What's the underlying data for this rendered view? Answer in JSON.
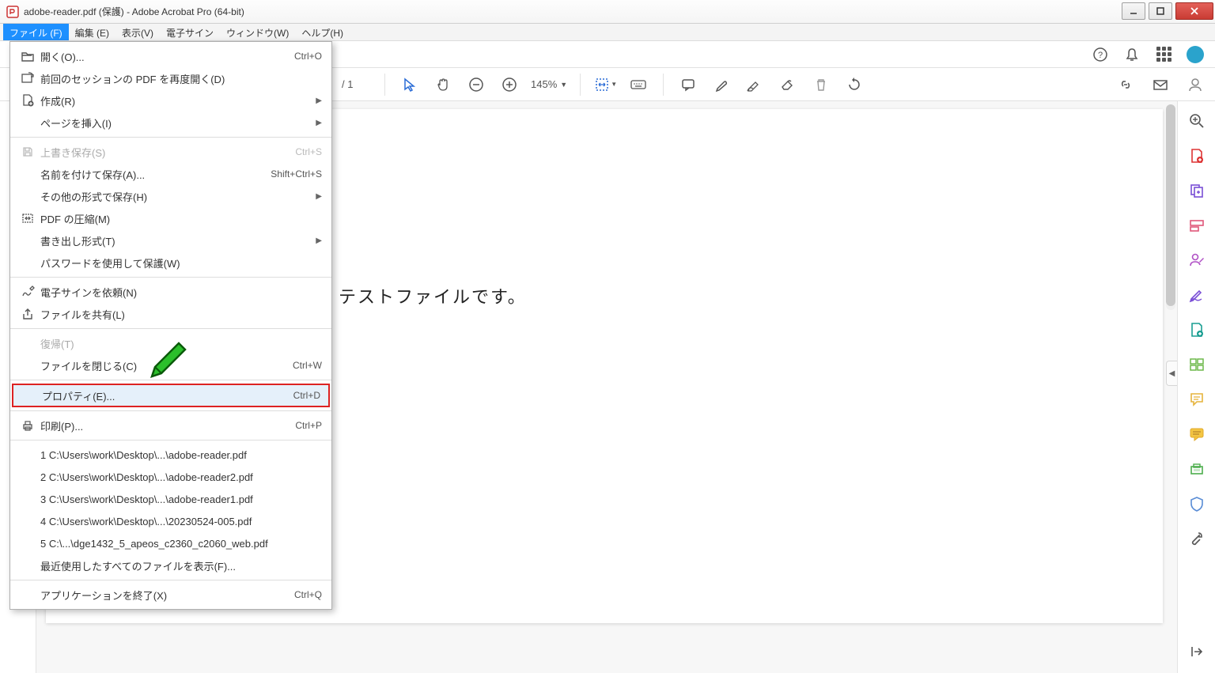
{
  "titlebar": {
    "title": "adobe-reader.pdf (保護) - Adobe Acrobat Pro (64-bit)"
  },
  "menubar": {
    "items": [
      {
        "label": "ファイル (F)",
        "active": true
      },
      {
        "label": "編集 (E)"
      },
      {
        "label": "表示(V)"
      },
      {
        "label": "電子サイン"
      },
      {
        "label": "ウィンドウ(W)"
      },
      {
        "label": "ヘルプ(H)"
      }
    ]
  },
  "toolbar2": {
    "page_total": "/ 1",
    "zoom": "145%"
  },
  "dropdown": {
    "groups": [
      [
        {
          "icon": "folder-open",
          "label": "開く(O)...",
          "shortcut": "Ctrl+O"
        },
        {
          "icon": "reopen",
          "label": "前回のセッションの PDF を再度開く(D)"
        },
        {
          "icon": "create",
          "label": "作成(R)",
          "submenu": true
        },
        {
          "label": "ページを挿入(I)",
          "submenu": true
        }
      ],
      [
        {
          "icon": "save",
          "label": "上書き保存(S)",
          "shortcut": "Ctrl+S",
          "disabled": true
        },
        {
          "label": "名前を付けて保存(A)...",
          "shortcut": "Shift+Ctrl+S"
        },
        {
          "label": "その他の形式で保存(H)",
          "submenu": true
        },
        {
          "icon": "compress",
          "label": "PDF の圧縮(M)"
        },
        {
          "label": "書き出し形式(T)",
          "submenu": true
        },
        {
          "label": "パスワードを使用して保護(W)"
        }
      ],
      [
        {
          "icon": "esign",
          "label": "電子サインを依頼(N)"
        },
        {
          "icon": "share",
          "label": "ファイルを共有(L)"
        }
      ],
      [
        {
          "label": "復帰(T)",
          "disabled": true
        },
        {
          "label": "ファイルを閉じる(C)",
          "shortcut": "Ctrl+W"
        }
      ],
      [
        {
          "label": "プロパティ(E)...",
          "shortcut": "Ctrl+D",
          "highlighted": true
        }
      ],
      [
        {
          "icon": "print",
          "label": "印刷(P)...",
          "shortcut": "Ctrl+P"
        }
      ],
      [
        {
          "label": "1 C:\\Users\\work\\Desktop\\...\\adobe-reader.pdf"
        },
        {
          "label": "2 C:\\Users\\work\\Desktop\\...\\adobe-reader2.pdf"
        },
        {
          "label": "3 C:\\Users\\work\\Desktop\\...\\adobe-reader1.pdf"
        },
        {
          "label": "4 C:\\Users\\work\\Desktop\\...\\20230524-005.pdf"
        },
        {
          "label": "5 C:\\...\\dge1432_5_apeos_c2360_c2060_web.pdf"
        },
        {
          "label": "最近使用したすべてのファイルを表示(F)..."
        }
      ],
      [
        {
          "label": "アプリケーションを終了(X)",
          "shortcut": "Ctrl+Q"
        }
      ]
    ]
  },
  "document": {
    "body_text": "テストファイルです。"
  }
}
